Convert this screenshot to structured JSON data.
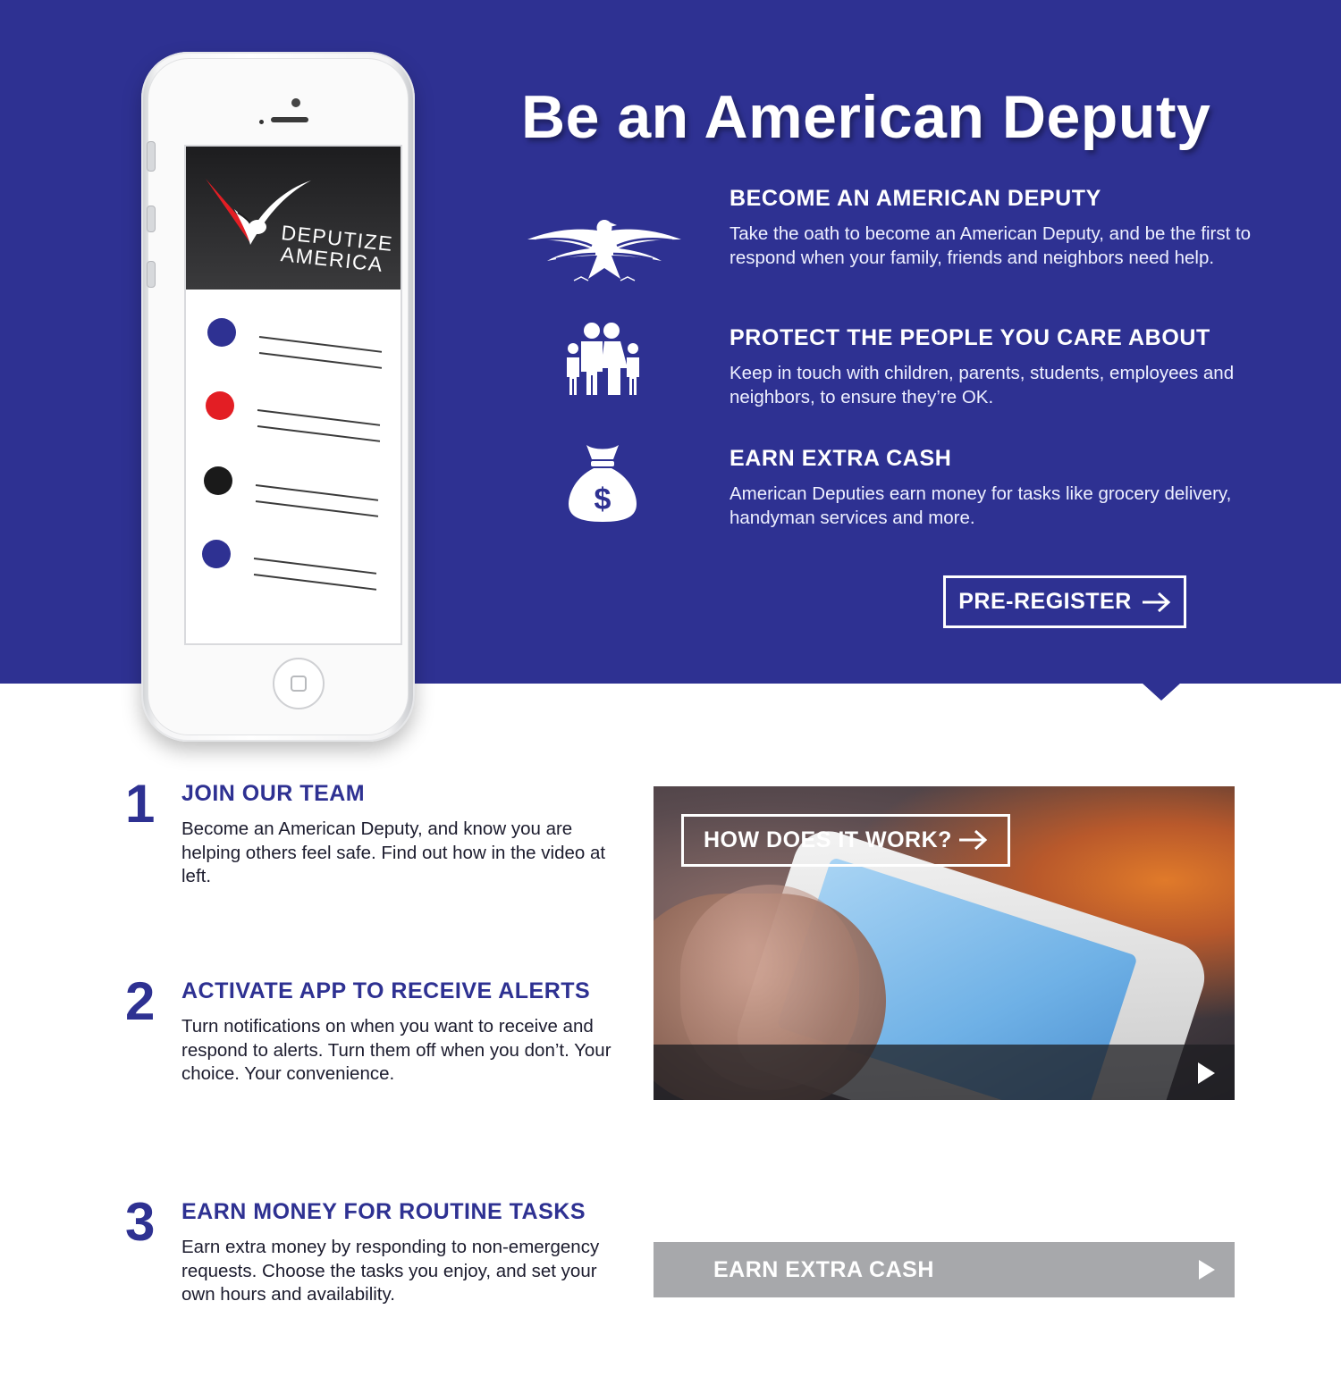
{
  "hero": {
    "title": "Be an American Deputy",
    "background_color": "#2e3192",
    "features": [
      {
        "icon": "eagle-star-icon",
        "heading": "BECOME AN AMERICAN DEPUTY",
        "text": "Take the oath to become an American Deputy, and be the first to respond when your family, friends and neighbors need help."
      },
      {
        "icon": "family-icon",
        "heading": "PROTECT THE PEOPLE YOU CARE ABOUT",
        "text": "Keep in touch with children, parents, students, employees and neighbors, to ensure they’re OK."
      },
      {
        "icon": "money-bag-icon",
        "heading": "EARN EXTRA CASH",
        "text": "American Deputies earn money for tasks like grocery delivery, handyman services and more."
      }
    ],
    "preregister_label": "PRE-REGISTER"
  },
  "phone_mockup": {
    "logo_line1": "DEPUTIZE",
    "logo_line2": "AMERICA",
    "list_dot_colors": [
      "#2e3192",
      "#e31e24",
      "#1a1a1a",
      "#2e3192"
    ]
  },
  "steps": [
    {
      "number": "1",
      "heading": "JOIN OUR TEAM",
      "text": "Become an American Deputy, and know you are helping others feel safe. Find out how in the video at left."
    },
    {
      "number": "2",
      "heading": "ACTIVATE APP TO RECEIVE ALERTS",
      "text": "Turn notifications on when you want to receive and respond to alerts. Turn them off when you don’t. Your choice. Your convenience."
    },
    {
      "number": "3",
      "heading": "EARN MONEY FOR ROUTINE TASKS",
      "text": "Earn extra money by responding to non-emergency requests. Choose the tasks you enjoy, and set your own hours and availability."
    }
  ],
  "video": {
    "overlay_button_label": "HOW DOES IT WORK?"
  },
  "cash_bar": {
    "label": "EARN EXTRA CASH",
    "color": "#a7a8ab"
  }
}
